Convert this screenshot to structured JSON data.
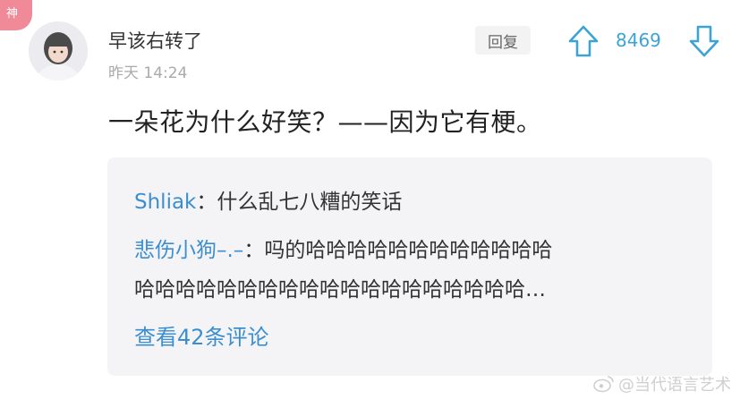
{
  "corner_badge": "神",
  "comment": {
    "username": "早该右转了",
    "timestamp": "昨天 14:24",
    "reply_label": "回复",
    "vote_count": "8469",
    "text": "一朵花为什么好笑？——因为它有梗。"
  },
  "replies": [
    {
      "name": "Shliak",
      "separator": "：",
      "text": "什么乱七八糟的笑话"
    },
    {
      "name": "悲伤小狗–.–",
      "separator": "：",
      "text": "吗的哈哈哈哈哈哈哈哈哈哈哈哈"
    },
    {
      "continuation": "哈哈哈哈哈哈哈哈哈哈哈哈哈哈哈哈哈哈哈…"
    }
  ],
  "view_more_label": "查看42条评论",
  "watermark": "@当代语言艺术",
  "colors": {
    "accent_blue": "#3b8fd0",
    "vote_blue": "#3ba3d6",
    "badge_pink": "#f08a98"
  },
  "icons": [
    "upvote-arrow-icon",
    "downvote-arrow-icon",
    "weibo-logo-icon"
  ]
}
